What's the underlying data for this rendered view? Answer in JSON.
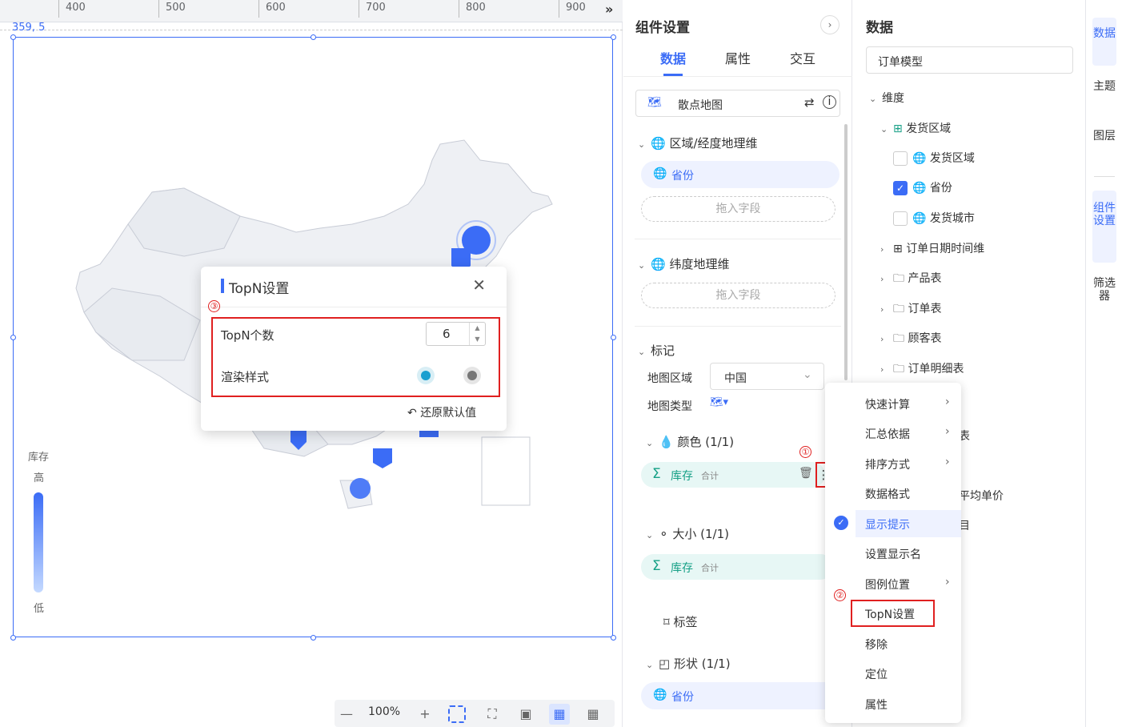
{
  "canvas": {
    "ruler_ticks": [
      "400",
      "500",
      "600",
      "700",
      "800",
      "900"
    ],
    "ruler_expand_icon": "double-chevron-right-icon",
    "coord_label": "359, 5",
    "legend": {
      "title": "库存",
      "high": "高",
      "low": "低"
    }
  },
  "zoombar": {
    "zoom_out": "—",
    "zoom_level": "100%",
    "zoom_in": "+"
  },
  "topn_dialog": {
    "title": "TopN设置",
    "close_icon": "close-icon",
    "marker_3": "③",
    "count_label": "TopN个数",
    "count_value": "6",
    "render_label": "渲染样式",
    "restore_label": "还原默认值"
  },
  "config_panel": {
    "title": "组件设置",
    "tabs": [
      "数据",
      "属性",
      "交互"
    ],
    "chart_type": "散点地图",
    "geo_region_section": "区域/经度地理维",
    "geo_region_field": "省份",
    "drop_hint": "拖入字段",
    "lat_section": "纬度地理维",
    "marks_section": "标记",
    "map_area_label": "地图区域",
    "map_area_value": "中国",
    "map_type_label": "地图类型",
    "color_section": "颜色 (1/1)",
    "color_field": "库存",
    "color_agg": "合计",
    "marker_1": "①",
    "size_section": "大小 (1/1)",
    "size_field": "库存",
    "size_agg": "合计",
    "label_section": "标签",
    "shape_section": "形状 (1/1)",
    "shape_field": "省份"
  },
  "data_panel": {
    "title": "数据",
    "model": "订单模型",
    "dimension": "维度",
    "tree": [
      {
        "label": "发货区域"
      },
      {
        "label": "发货区域"
      },
      {
        "label": "省份"
      },
      {
        "label": "发货城市"
      },
      {
        "label": "订单日期时间维"
      },
      {
        "label": "产品表"
      },
      {
        "label": "订单表"
      },
      {
        "label": "顾客表"
      },
      {
        "label": "订单明细表"
      }
    ],
    "partial_1": "表",
    "partial_2": "平均单价",
    "partial_3": "目"
  },
  "rail": [
    "数据",
    "主题",
    "图层",
    "组件设置",
    "筛选器"
  ],
  "context_menu": {
    "items": [
      "快速计算",
      "汇总依据",
      "排序方式",
      "数据格式",
      "显示提示",
      "设置显示名",
      "图例位置",
      "TopN设置",
      "移除",
      "定位",
      "属性"
    ],
    "marker_2": "②"
  },
  "colors": {
    "accent": "#3b6cf6",
    "highlight": "#e02020",
    "green": "#16a086"
  }
}
